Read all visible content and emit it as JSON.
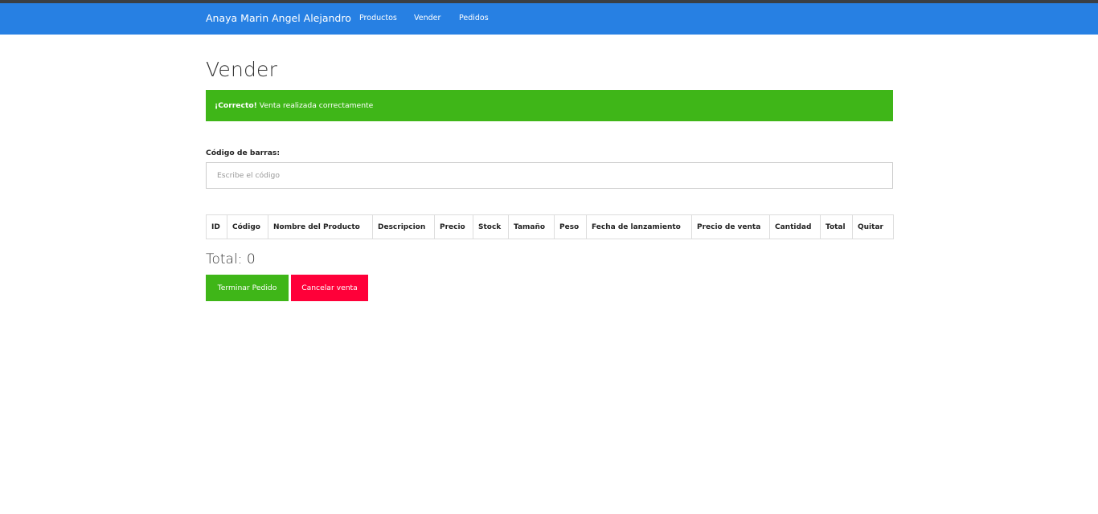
{
  "navbar": {
    "brand": "Anaya Marin Angel Alejandro",
    "links": [
      "Productos",
      "Vender",
      "Pedidos"
    ]
  },
  "page": {
    "title": "Vender"
  },
  "alert": {
    "strong": "¡Correcto!",
    "message": " Venta realizada correctamente"
  },
  "barcode": {
    "label": "Código de barras:",
    "placeholder": "Escribe el código",
    "value": ""
  },
  "table": {
    "headers": [
      "ID",
      "Código",
      "Nombre del Producto",
      "Descripcion",
      "Precio",
      "Stock",
      "Tamaño",
      "Peso",
      "Fecha de lanzamiento",
      "Precio de venta",
      "Cantidad",
      "Total",
      "Quitar"
    ],
    "rows": []
  },
  "total": {
    "text": "Total: 0"
  },
  "buttons": {
    "finish": "Terminar Pedido",
    "cancel": "Cancelar venta"
  },
  "colors": {
    "navbar": "#2780e3",
    "success": "#3fb618",
    "danger": "#ff0039"
  }
}
